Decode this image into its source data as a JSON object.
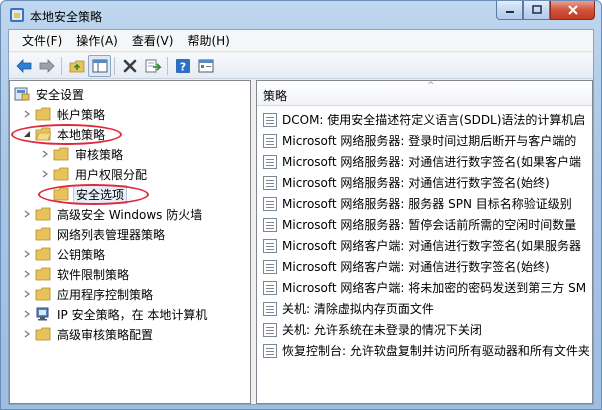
{
  "window": {
    "title": "本地安全策略"
  },
  "menu": [
    {
      "label": "文件(F)"
    },
    {
      "label": "操作(A)"
    },
    {
      "label": "查看(V)"
    },
    {
      "label": "帮助(H)"
    }
  ],
  "toolbar": {
    "icons": [
      "back-arrow-icon",
      "forward-arrow-icon",
      "up-folder-icon",
      "show-hide-tree-icon",
      "delete-icon",
      "export-list-icon",
      "help-icon",
      "properties-icon"
    ]
  },
  "tree": {
    "root": "安全设置",
    "items": [
      {
        "label": "帐户策略"
      },
      {
        "label": "本地策略"
      },
      {
        "label": "审核策略"
      },
      {
        "label": "用户权限分配"
      },
      {
        "label": "安全选项"
      },
      {
        "label": "高级安全 Windows 防火墙"
      },
      {
        "label": "网络列表管理器策略"
      },
      {
        "label": "公钥策略"
      },
      {
        "label": "软件限制策略"
      },
      {
        "label": "应用程序控制策略"
      },
      {
        "label": "IP 安全策略，在 本地计算机"
      },
      {
        "label": "高级审核策略配置"
      }
    ]
  },
  "list": {
    "column_header": "策略",
    "rows": [
      "DCOM: 使用安全描述符定义语言(SDDL)语法的计算机启",
      "Microsoft 网络服务器: 登录时间过期后断开与客户端的",
      "Microsoft 网络服务器: 对通信进行数字签名(如果客户端",
      "Microsoft 网络服务器: 对通信进行数字签名(始终)",
      "Microsoft 网络服务器: 服务器 SPN 目标名称验证级别",
      "Microsoft 网络服务器: 暂停会话前所需的空闲时间数量",
      "Microsoft 网络客户端: 对通信进行数字签名(如果服务器",
      "Microsoft 网络客户端: 对通信进行数字签名(始终)",
      "Microsoft 网络客户端: 将未加密的密码发送到第三方 SM",
      "关机: 清除虚拟内存页面文件",
      "关机: 允许系统在未登录的情况下关闭",
      "恢复控制台: 允许软盘复制并访问所有驱动器和所有文件夹"
    ]
  },
  "colors": {
    "annotation": "#e0283c",
    "folder": "#e8c25a",
    "selection": "#e8eef7"
  }
}
